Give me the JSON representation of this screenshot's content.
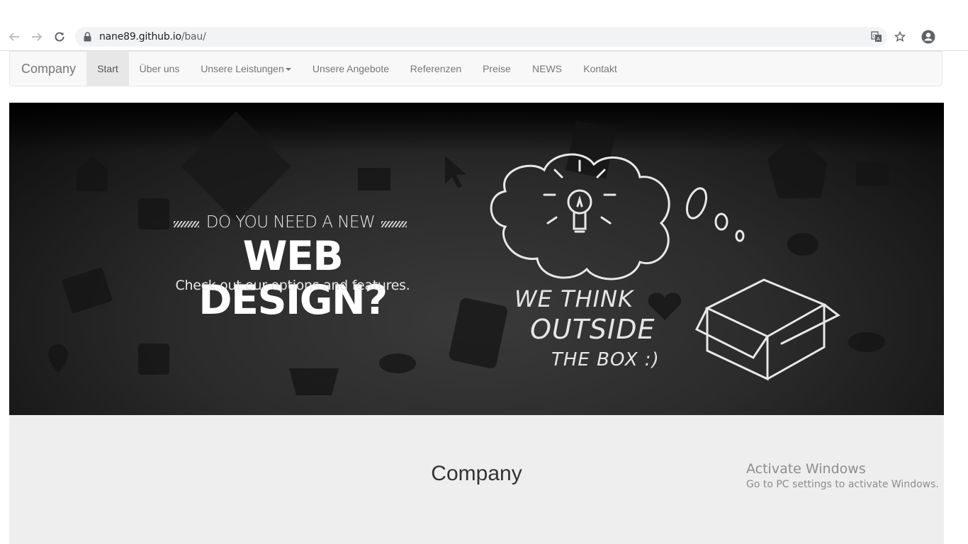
{
  "browser": {
    "url_host": "nane89.github.io",
    "url_path": "/bau/",
    "icons": [
      "back-arrow-icon",
      "forward-arrow-icon",
      "reload-icon",
      "lock-icon",
      "translate-icon",
      "star-icon",
      "account-icon"
    ]
  },
  "navbar": {
    "brand": "Company",
    "items": [
      {
        "label": "Start",
        "active": true
      },
      {
        "label": "Über uns"
      },
      {
        "label": "Unsere Leistungen",
        "dropdown": true
      },
      {
        "label": "Unsere Angebote"
      },
      {
        "label": "Referenzen"
      },
      {
        "label": "Preise"
      },
      {
        "label": "NEWS"
      },
      {
        "label": "Kontakt"
      }
    ]
  },
  "hero": {
    "line1": "DO YOU NEED A NEW",
    "line2": "WEB DESIGN?",
    "line3": "Check out our options and features.",
    "chalk1": "WE  THINK",
    "chalk2": "OUTSIDE",
    "chalk3": "THE  BOX :)"
  },
  "content": {
    "title": "Company"
  },
  "watermark": {
    "title": "Activate Windows",
    "subtitle": "Go to PC settings to activate Windows."
  },
  "colors": {
    "navbar_bg": "#f8f8f8",
    "nav_text": "#777777",
    "nav_active_bg": "#e7e7e7",
    "content_bg": "#eeeeee"
  }
}
